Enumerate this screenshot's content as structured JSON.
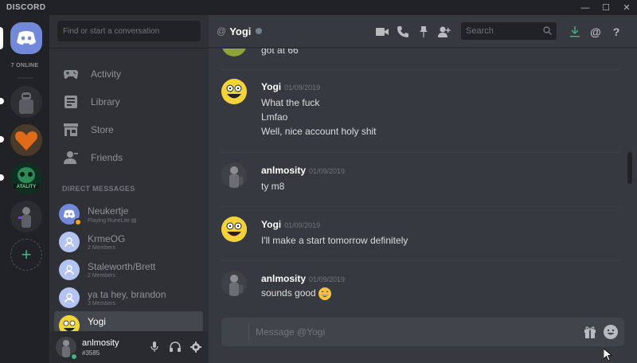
{
  "titlebar": {
    "brand": "DISCORD",
    "controls": [
      "minimize",
      "maximize",
      "close"
    ]
  },
  "servers": {
    "online_label": "7 ONLINE",
    "icons": [
      "home-icon",
      "server-avatar-knight",
      "server-avatar-heart",
      "server-avatar-fatality",
      "server-avatar-figure",
      "add-server-icon"
    ]
  },
  "sidebar": {
    "search_placeholder": "Find or start a conversation",
    "nav": [
      {
        "label": "Activity",
        "icon": "gamepad-icon"
      },
      {
        "label": "Library",
        "icon": "library-icon"
      },
      {
        "label": "Store",
        "icon": "store-icon"
      },
      {
        "label": "Friends",
        "icon": "friends-icon"
      }
    ],
    "dm_header": "DIRECT MESSAGES",
    "dms": [
      {
        "name": "Neukertje",
        "sub": "Playing RuneLite"
      },
      {
        "name": "KrmeOG",
        "sub": "2 Members"
      },
      {
        "name": "Staleworth/Brett",
        "sub": "2 Members"
      },
      {
        "name": "ya ta hey, brandon",
        "sub": "3 Members"
      },
      {
        "name": "Yogi",
        "sub": ""
      }
    ]
  },
  "user": {
    "name": "anlmosity",
    "tag": "#3585"
  },
  "chat": {
    "at_symbol": "@",
    "title": "Yogi",
    "search_placeholder": "Search",
    "header_icons": [
      "video-call-icon",
      "voice-call-icon",
      "pin-icon",
      "add-friend-icon",
      "download-icon",
      "mention-icon",
      "help-icon"
    ],
    "partial_line": "got at 66",
    "groups": [
      {
        "author": "Yogi",
        "time": "01/09/2019",
        "lines": [
          "What the fuck",
          "Lmfao",
          "Well, nice account holy shit"
        ]
      },
      {
        "author": "anlmosity",
        "time": "01/09/2019",
        "lines": [
          "ty m8"
        ]
      },
      {
        "author": "Yogi",
        "time": "01/09/2019",
        "lines": [
          "I'll make a start tomorrow definitely"
        ]
      },
      {
        "author": "anlmosity",
        "time": "01/09/2019",
        "lines": [
          "sounds good"
        ]
      }
    ],
    "composer_placeholder": "Message @Yogi"
  },
  "colors": {
    "blurple": "#7289da",
    "online": "#43b581",
    "idle": "#faa61a",
    "chat_bg": "#36393f",
    "sidebar_bg": "#2f3136",
    "rail_bg": "#202225"
  }
}
